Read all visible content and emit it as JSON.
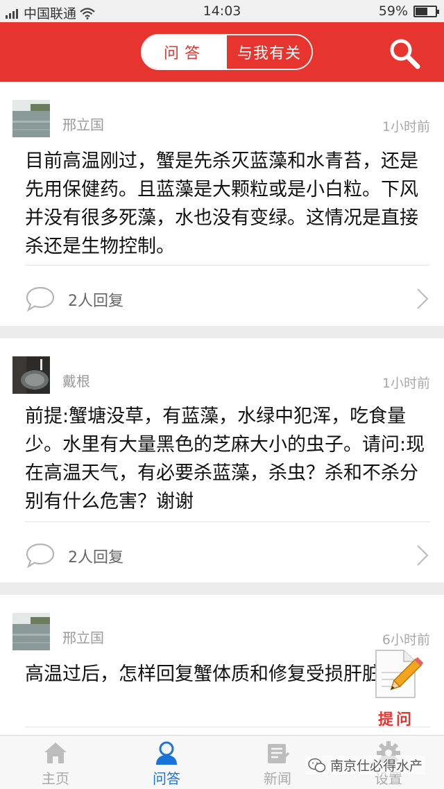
{
  "status_bar": {
    "carrier": "中国联通",
    "time": "14:03",
    "battery": "59%",
    "battery_level": 0.59
  },
  "header": {
    "tabs": [
      {
        "label": "问答",
        "active": true
      },
      {
        "label": "与我有关",
        "active": false
      }
    ],
    "icons": {
      "search": "search-icon"
    }
  },
  "posts": [
    {
      "author": "邢立国",
      "time": "1小时前",
      "text": "目前高温刚过，蟹是先杀灭蓝藻和水青苔，还是先用保健药。且蓝藻是大颗粒或是小白粒。下风并没有很多死藻，水也没有变绿。这情况是直接杀还是生物控制。",
      "replies": "2人回复"
    },
    {
      "author": "戴根",
      "time": "1小时前",
      "text": "前提:蟹塘没草，有蓝藻，水绿中犯浑，吃食量少。水里有大量黑色的芝麻大小的虫子。请问:现在高温天气，有必要杀蓝藻，杀虫？杀和不杀分别有什么危害？谢谢",
      "replies": "2人回复"
    },
    {
      "author": "邢立国",
      "time": "6小时前",
      "text": "高温过后，怎样回复蟹体质和修复受损肝脏。"
    }
  ],
  "fab": {
    "label": "提问",
    "icon": "edit-icon"
  },
  "bottom_nav": [
    {
      "label": "主页",
      "icon": "home-icon",
      "active": false
    },
    {
      "label": "问答",
      "icon": "user-icon",
      "active": true
    },
    {
      "label": "新闻",
      "icon": "news-icon",
      "active": false
    },
    {
      "label": "设置",
      "icon": "gear-icon",
      "active": false
    }
  ],
  "watermark": "南京仕必得水产",
  "colors": {
    "accent": "#e8342f",
    "active_nav": "#1a73d9",
    "muted": "#a8a8a8"
  }
}
